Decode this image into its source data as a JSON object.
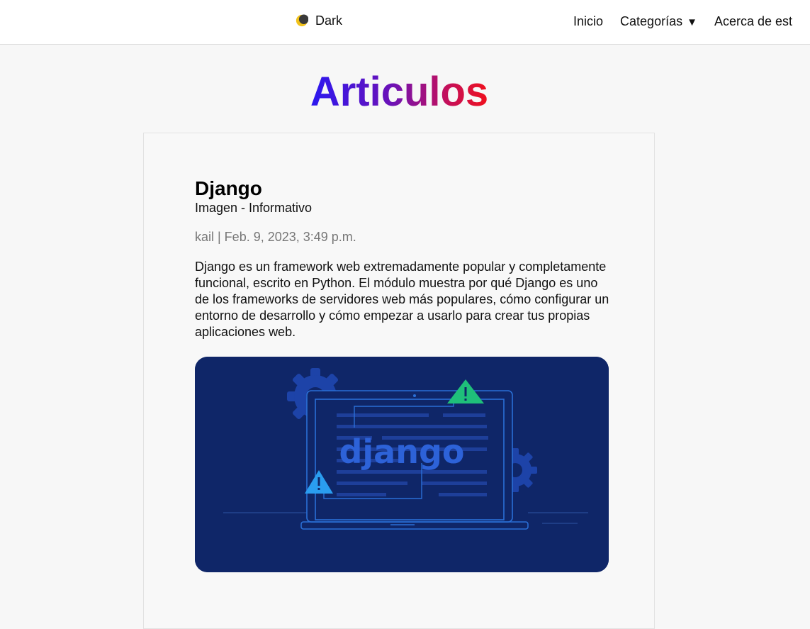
{
  "header": {
    "theme_toggle": {
      "label": "Dark",
      "icon": "moon-icon"
    },
    "nav": [
      {
        "label": "Inicio"
      },
      {
        "label": "Categorías",
        "caret": "▼"
      },
      {
        "label": "Acerca de est"
      }
    ]
  },
  "page": {
    "title": "Articulos"
  },
  "post": {
    "title": "Django",
    "category": "Imagen - Informativo",
    "meta": "kail | Feb. 9, 2023, 3:49 p.m.",
    "body": "Django es un framework web extremadamente popular y completamente funcional, escrito en Python. El módulo muestra por qué Django es uno de los frameworks de servidores web más populares, cómo configurar un entorno de desarrollo y cómo empezar a usarlo para crear tus propias aplicaciones web.",
    "image": {
      "word": "django"
    }
  },
  "colors": {
    "title_gradient": [
      "#2b18f0",
      "#6a12b8",
      "#c01060",
      "#f0101c"
    ],
    "image_background": "#0f2668",
    "warning_green": "#1fbf7a",
    "warning_blue": "#2a9df0"
  }
}
